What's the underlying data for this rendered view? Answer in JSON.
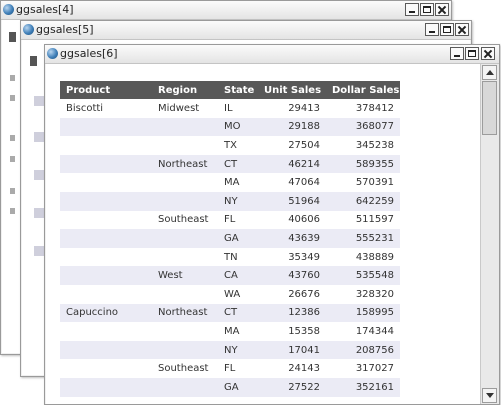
{
  "windows": [
    {
      "title": "ggsales[4]"
    },
    {
      "title": "ggsales[5]"
    },
    {
      "title": "ggsales[6]"
    }
  ],
  "table": {
    "columns": [
      "Product",
      "Region",
      "State",
      "Unit Sales",
      "Dollar Sales"
    ],
    "rows": [
      [
        "Biscotti",
        "Midwest",
        "IL",
        "29413",
        "378412"
      ],
      [
        "",
        "",
        "MO",
        "29188",
        "368077"
      ],
      [
        "",
        "",
        "TX",
        "27504",
        "345238"
      ],
      [
        "",
        "Northeast",
        "CT",
        "46214",
        "589355"
      ],
      [
        "",
        "",
        "MA",
        "47064",
        "570391"
      ],
      [
        "",
        "",
        "NY",
        "51964",
        "642259"
      ],
      [
        "",
        "Southeast",
        "FL",
        "40606",
        "511597"
      ],
      [
        "",
        "",
        "GA",
        "43639",
        "555231"
      ],
      [
        "",
        "",
        "TN",
        "35349",
        "438889"
      ],
      [
        "",
        "West",
        "CA",
        "43760",
        "535548"
      ],
      [
        "",
        "",
        "WA",
        "26676",
        "328320"
      ],
      [
        "Capuccino",
        "Northeast",
        "CT",
        "12386",
        "158995"
      ],
      [
        "",
        "",
        "MA",
        "15358",
        "174344"
      ],
      [
        "",
        "",
        "NY",
        "17041",
        "208756"
      ],
      [
        "",
        "Southeast",
        "FL",
        "24143",
        "317027"
      ],
      [
        "",
        "",
        "GA",
        "27522",
        "352161"
      ]
    ]
  },
  "icons": {
    "window_icon": "app-globe-icon",
    "minimize": "minimize-icon",
    "maximize": "maximize-icon",
    "close": "close-icon",
    "scroll_up": "arrow-up-icon",
    "scroll_down": "arrow-down-icon"
  },
  "colors": {
    "header_bg": "#585858",
    "header_text": "#ffffff",
    "stripe": "#ebebf5",
    "window_frame": "#f0f0f0"
  }
}
